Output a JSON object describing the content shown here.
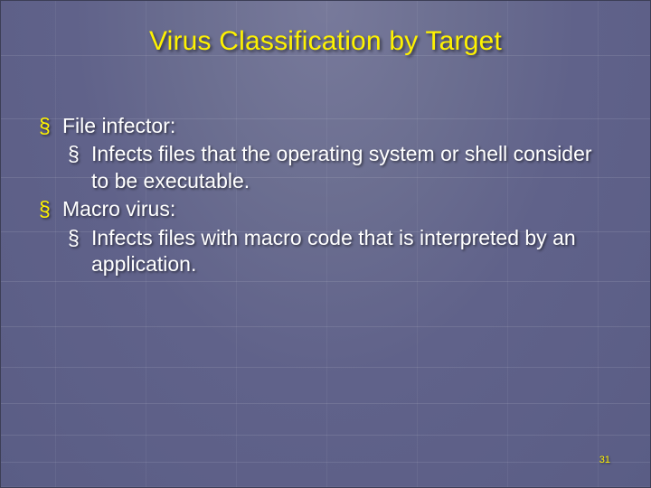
{
  "title": "Virus Classification by Target",
  "bullets": [
    {
      "term": "File infector:",
      "desc": "Infects files that the operating system or shell consider to be executable."
    },
    {
      "term": "Macro virus:",
      "desc": "Infects files with macro code that is interpreted by an application."
    }
  ],
  "page_number": "31"
}
